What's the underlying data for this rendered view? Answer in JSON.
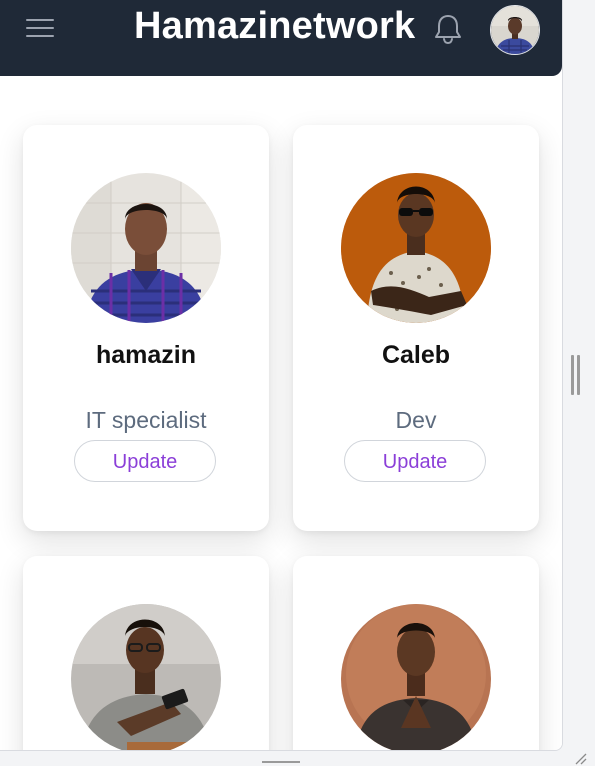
{
  "header": {
    "brand": "Hamazinetwork",
    "background_color": "#1f2937",
    "icons": [
      "menu-icon",
      "bell-icon",
      "user-avatar"
    ]
  },
  "profiles": [
    {
      "name": "hamazin",
      "role": "IT specialist",
      "button_label": "Update",
      "photo": "man-in-plaid-shirt"
    },
    {
      "name": "Caleb",
      "role": "Dev",
      "button_label": "Update",
      "photo": "man-with-sunglasses-orange-background"
    },
    {
      "name": "",
      "role": "",
      "button_label": "",
      "photo": "man-with-glasses-holding-phone"
    },
    {
      "name": "",
      "role": "",
      "button_label": "",
      "photo": "man-in-dark-sweater-hands-clasped"
    }
  ],
  "colors": {
    "accent": "#8b3fd8",
    "role_text": "#5d6b7e",
    "card_background": "#ffffff"
  }
}
